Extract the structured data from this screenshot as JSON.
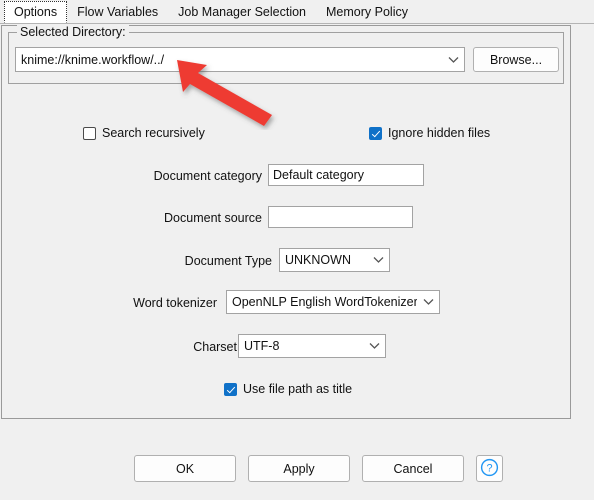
{
  "tabs": [
    {
      "label": "Options",
      "selected": true
    },
    {
      "label": "Flow Variables",
      "selected": false
    },
    {
      "label": "Job Manager Selection",
      "selected": false
    },
    {
      "label": "Memory Policy",
      "selected": false
    }
  ],
  "directory_group": {
    "legend": "Selected Directory:",
    "path_value": "knime://knime.workflow/../",
    "browse_label": "Browse..."
  },
  "checkboxes": {
    "search_recursively": {
      "label": "Search recursively",
      "checked": false
    },
    "ignore_hidden_files": {
      "label": "Ignore hidden files",
      "checked": true
    },
    "use_file_path_as_title": {
      "label": "Use file path as title",
      "checked": true
    }
  },
  "fields": {
    "document_category": {
      "label": "Document category",
      "value": "Default category",
      "placeholder": ""
    },
    "document_source": {
      "label": "Document source",
      "value": "",
      "placeholder": ""
    },
    "document_type": {
      "label": "Document Type",
      "value": "UNKNOWN"
    },
    "word_tokenizer": {
      "label": "Word tokenizer",
      "value": "OpenNLP English WordTokenizer"
    },
    "charset": {
      "label": "Charset",
      "value": "UTF-8"
    }
  },
  "buttons": {
    "ok": "OK",
    "apply": "Apply",
    "cancel": "Cancel",
    "help": "?"
  },
  "colors": {
    "accent_checkbox": "#0f71c8",
    "help_icon": "#2196f3",
    "annotation_arrow": "#ee3b33",
    "panel_bg": "#f0f0f0",
    "field_bg": "#ffffff"
  }
}
